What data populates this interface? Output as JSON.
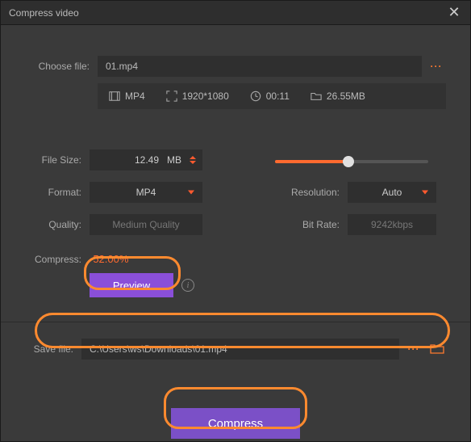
{
  "window": {
    "title": "Compress video"
  },
  "choose_file": {
    "label": "Choose file:",
    "value": "01.mp4"
  },
  "file_meta": {
    "format": "MP4",
    "resolution": "1920*1080",
    "duration": "00:11",
    "size": "26.55MB"
  },
  "settings": {
    "file_size": {
      "label": "File Size:",
      "value": "12.49",
      "unit": "MB"
    },
    "format": {
      "label": "Format:",
      "value": "MP4"
    },
    "quality": {
      "label": "Quality:",
      "value": "Medium Quality"
    },
    "resolution": {
      "label": "Resolution:",
      "value": "Auto"
    },
    "bitrate": {
      "label": "Bit Rate:",
      "value": "9242kbps"
    }
  },
  "compress_stat": {
    "label": "Compress:",
    "value": "-52.00%"
  },
  "buttons": {
    "preview": "Preview",
    "compress": "Compress"
  },
  "save_file": {
    "label": "Save file:",
    "value": "C:\\Users\\ws\\Downloads\\01.mp4"
  },
  "slider": {
    "percent": 48
  },
  "colors": {
    "accent_orange": "#ff6a2f",
    "accent_purple": "#7b50c7"
  }
}
